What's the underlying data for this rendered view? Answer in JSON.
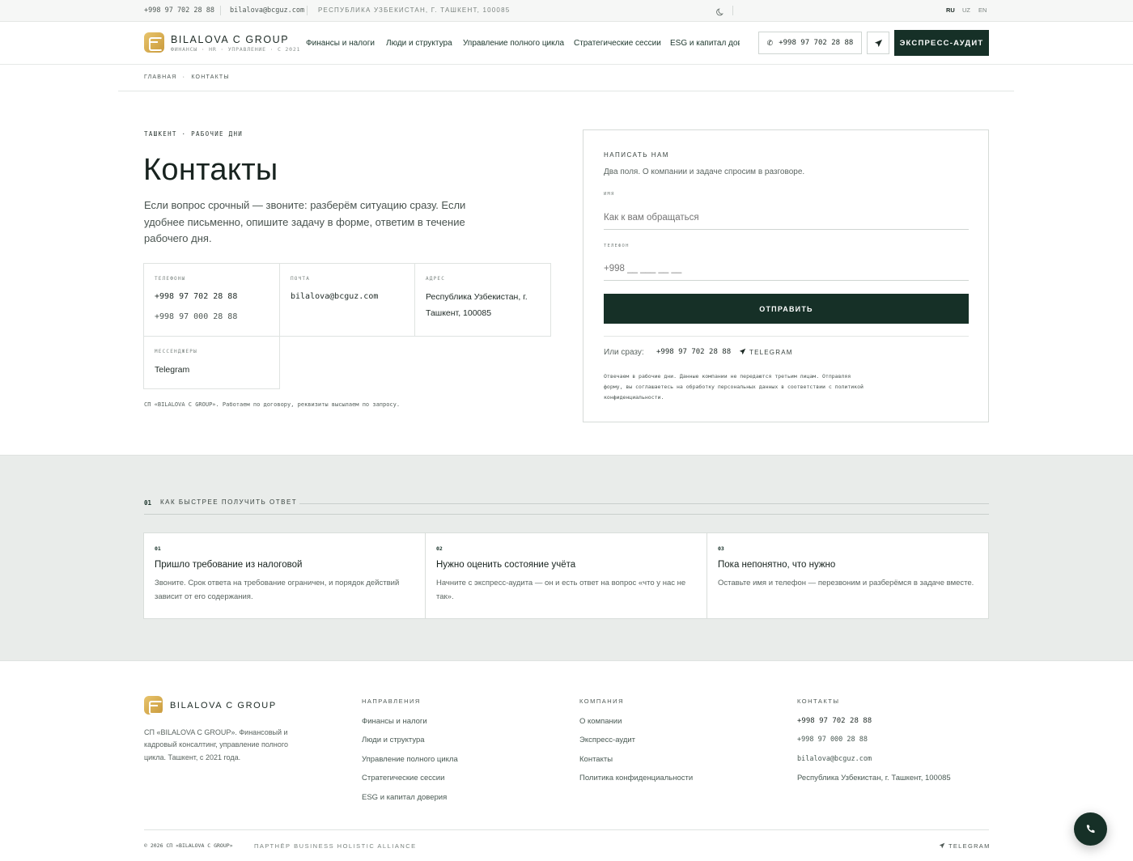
{
  "topbar": {
    "phone": "+998 97 702 28 88",
    "email": "bilalova@bcguz.com",
    "address": "РЕСПУБЛИКА УЗБЕКИСТАН, Г. ТАШКЕНТ, 100085",
    "theme_icon": "moon-icon",
    "languages": [
      "RU",
      "UZ",
      "EN"
    ],
    "active_language": "RU"
  },
  "header": {
    "brand": "BILALOVA C GROUP",
    "brand_sub": "ФИНАНСЫ · HR · УПРАВЛЕНИЕ · С 2021",
    "nav": [
      "Финансы и налоги",
      "Люди и структура",
      "Управление полного цикла",
      "Стратегические сессии",
      "ESG и капитал дове"
    ],
    "phone_btn": "+998 97 702 28 88",
    "cta": "ЭКСПРЕСС-АУДИТ"
  },
  "breadcrumb": {
    "home": "ГЛАВНАЯ",
    "sep": "·",
    "current": "КОНТАКТЫ"
  },
  "hero": {
    "kicker": "ТАШКЕНТ · РАБОЧИЕ ДНИ",
    "title": "Контакты",
    "lead": "Если вопрос срочный — звоните: разберём ситуацию сразу. Если удобнее письменно, опишите задачу в форме, ответим в течение рабочего дня."
  },
  "contact_cards": {
    "phones_label": "ТЕЛЕФОНЫ",
    "phone1": "+998 97 702 28 88",
    "phone2": "+998 97 000 28 88",
    "mail_label": "ПОЧТА",
    "mail": "bilalova@bcguz.com",
    "address_label": "АДРЕС",
    "address": "Республика Узбекистан, г. Ташкент, 100085",
    "messengers_label": "МЕССЕНДЖЕРЫ",
    "messenger": "Telegram"
  },
  "note": "СП «BILALOVA C GROUP». Работаем по договору, реквизиты высылаем по запросу.",
  "form": {
    "title": "НАПИСАТЬ НАМ",
    "subtitle": "Два поля. О компании и задаче спросим в разговоре.",
    "name_label": "ИМЯ",
    "name_placeholder": "Как к вам обращаться",
    "phone_label": "ТЕЛЕФОН",
    "phone_placeholder": "+998 __ ___ __ __",
    "submit": "ОТПРАВИТЬ",
    "or_label": "Или сразу:",
    "or_phone": "+998 97 702 28 88",
    "or_telegram": "TELEGRAM",
    "legal": "Отвечаем в рабочие дни. Данные компании не передаются третьим лицам. Отправляя форму, вы соглашаетесь на обработку персональных данных в соответствии с политикой конфиденциальности."
  },
  "how": {
    "num": "01",
    "title": "КАК БЫСТРЕЕ ПОЛУЧИТЬ ОТВЕТ",
    "steps": [
      {
        "n": "01",
        "title": "Пришло требование из налоговой",
        "desc": "Звоните. Срок ответа на требование ограничен, и порядок действий зависит от его содержания."
      },
      {
        "n": "02",
        "title": "Нужно оценить состояние учёта",
        "desc": "Начните с экспресс-аудита — он и есть ответ на вопрос «что у нас не так»."
      },
      {
        "n": "03",
        "title": "Пока непонятно, что нужно",
        "desc": "Оставьте имя и телефон — перезвоним и разберёмся в задаче вместе."
      }
    ]
  },
  "footer": {
    "brand": "BILALOVA C GROUP",
    "desc": "СП «BILALOVA C GROUP». Финансовый и кадровый консалтинг, управление полного цикла. Ташкент, с 2021 года.",
    "directions_title": "НАПРАВЛЕНИЯ",
    "directions": [
      "Финансы и налоги",
      "Люди и структура",
      "Управление полного цикла",
      "Стратегические сессии",
      "ESG и капитал доверия"
    ],
    "company_title": "КОМПАНИЯ",
    "company": [
      "О компании",
      "Экспресс-аудит",
      "Контакты",
      "Политика конфиденциальности"
    ],
    "contacts_title": "КОНТАКТЫ",
    "contacts_phone1": "+998 97 702 28 88",
    "contacts_phone2": "+998 97 000 28 88",
    "contacts_mail": "bilalova@bcguz.com",
    "contacts_address": "Республика Узбекистан, г. Ташкент, 100085",
    "copyright": "© 2026 СП «BILALOVA C GROUP»",
    "partner": "ПАРТНЁР BUSINESS HOLISTIC ALLIANCE",
    "telegram": "TELEGRAM"
  },
  "colors": {
    "accent": "#163027",
    "gold": "#d4a94f",
    "band": "#e9ecea"
  }
}
